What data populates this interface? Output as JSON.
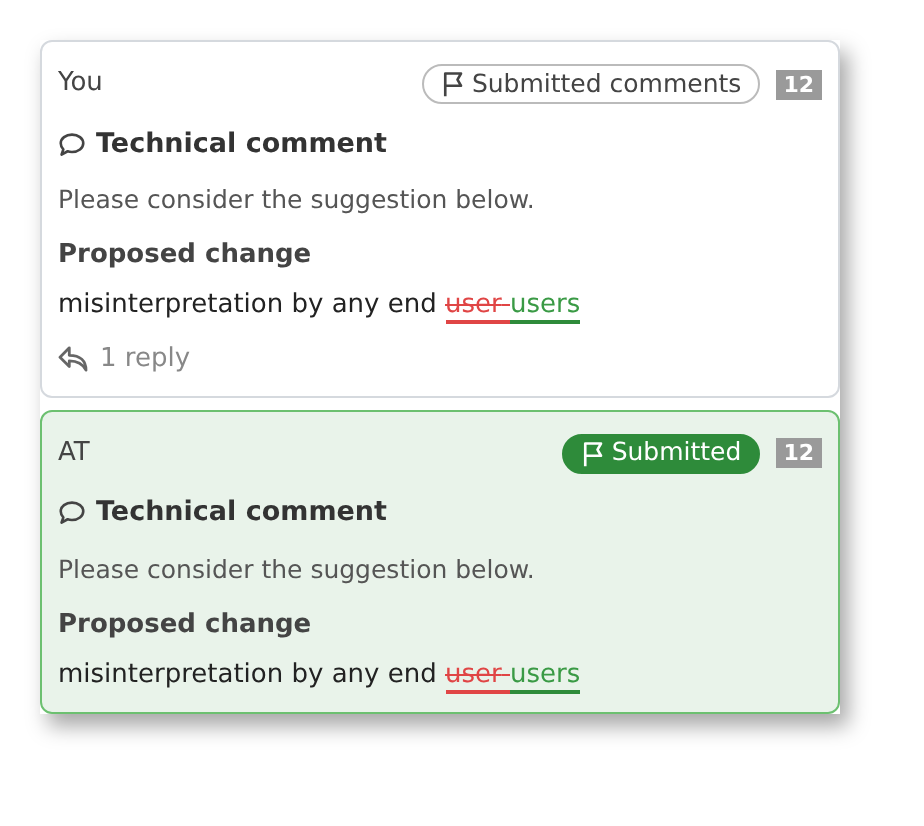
{
  "comments": [
    {
      "author": "You",
      "selected": false,
      "badge": {
        "kind": "outline",
        "label": "Submitted comments"
      },
      "count": "12",
      "type": "Technical comment",
      "body": "Please consider the suggestion below.",
      "change_title": "Proposed change",
      "change": {
        "text": "misinterpretation by any end",
        "deleted": "user",
        "inserted": "users"
      },
      "replies": "1 reply"
    },
    {
      "author": "AT",
      "selected": true,
      "badge": {
        "kind": "filled",
        "label": "Submitted"
      },
      "count": "12",
      "type": "Technical comment",
      "body": "Please consider the suggestion below.",
      "change_title": "Proposed change",
      "change": {
        "text": "misinterpretation by any end",
        "deleted": "user",
        "inserted": "users"
      }
    }
  ]
}
